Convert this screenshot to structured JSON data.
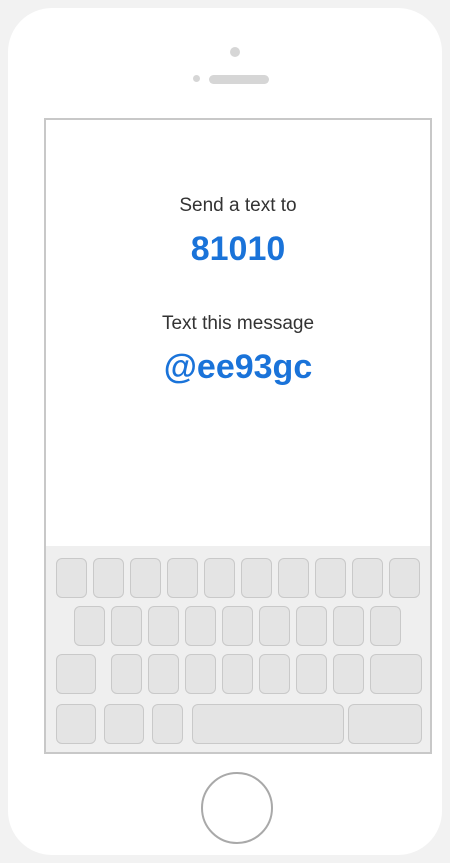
{
  "message_screen": {
    "send_label": "Send a text to",
    "phone_number": "81010",
    "message_label": "Text this message",
    "message_code": "@ee93gc"
  },
  "colors": {
    "accent": "#1a73d9",
    "label_text": "#333333",
    "keyboard_bg": "#efefef",
    "key_fill": "#e4e4e4",
    "key_border": "#c9c9c9"
  },
  "icons": {
    "camera": "camera-dot-icon",
    "speaker": "speaker-icon",
    "home": "home-button-icon"
  }
}
